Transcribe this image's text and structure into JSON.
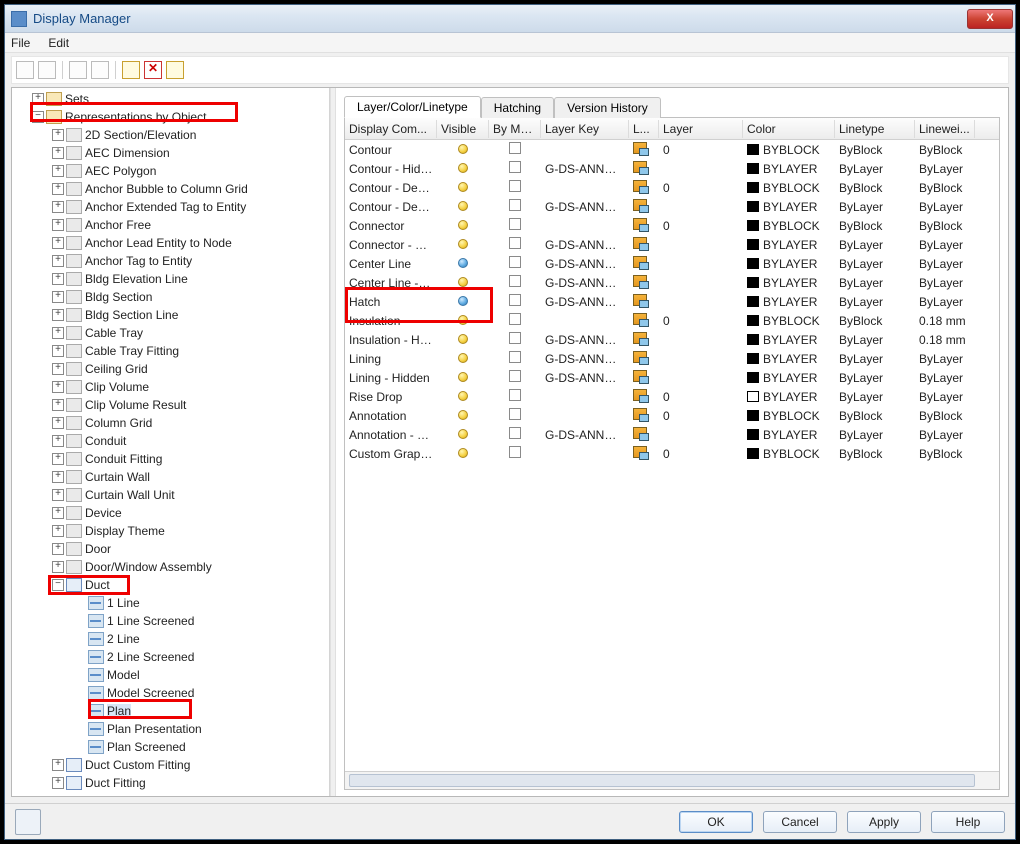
{
  "window": {
    "title": "Display Manager"
  },
  "menu": {
    "file": "File",
    "edit": "Edit"
  },
  "tree": {
    "sets": "Sets",
    "rep_by_obj": "Representations by Object",
    "items": [
      "2D Section/Elevation",
      "AEC Dimension",
      "AEC Polygon",
      "Anchor Bubble to Column Grid",
      "Anchor Extended Tag to Entity",
      "Anchor Free",
      "Anchor Lead Entity to Node",
      "Anchor Tag to Entity",
      "Bldg Elevation Line",
      "Bldg Section",
      "Bldg Section Line",
      "Cable Tray",
      "Cable Tray Fitting",
      "Ceiling Grid",
      "Clip Volume",
      "Clip Volume Result",
      "Column Grid",
      "Conduit",
      "Conduit Fitting",
      "Curtain Wall",
      "Curtain Wall Unit",
      "Device",
      "Display Theme",
      "Door",
      "Door/Window Assembly"
    ],
    "duct": "Duct",
    "duct_reps": [
      "1 Line",
      "1 Line Screened",
      "2 Line",
      "2 Line Screened",
      "Model",
      "Model Screened",
      "Plan",
      "Plan Presentation",
      "Plan Screened"
    ],
    "duct_custom": "Duct Custom Fitting",
    "duct_fitting": "Duct Fitting"
  },
  "tabs": {
    "lcl": "Layer/Color/Linetype",
    "hatch": "Hatching",
    "vh": "Version History"
  },
  "headers": [
    "Display Com...",
    "Visible",
    "By Mat...",
    "Layer Key",
    "L...",
    "Layer",
    "Color",
    "Linetype",
    "Linewei..."
  ],
  "rows": [
    {
      "name": "Contour",
      "bulb": "y",
      "key": "",
      "layer": "0",
      "color": "BYBLOCK",
      "lt": "ByBlock",
      "lw": "ByBlock",
      "sw": "b"
    },
    {
      "name": "Contour - Hidden",
      "bulb": "y",
      "key": "G-DS-ANNO-S...",
      "layer": "",
      "color": "BYLAYER",
      "lt": "ByLayer",
      "lw": "ByLayer",
      "sw": "b"
    },
    {
      "name": "Contour - Details",
      "bulb": "y",
      "key": "",
      "layer": "0",
      "color": "BYBLOCK",
      "lt": "ByBlock",
      "lw": "ByBlock",
      "sw": "b"
    },
    {
      "name": "Contour - Details -",
      "bulb": "y",
      "key": "G-DS-ANNO-S...",
      "layer": "",
      "color": "BYLAYER",
      "lt": "ByLayer",
      "lw": "ByLayer",
      "sw": "b"
    },
    {
      "name": "Connector",
      "bulb": "y",
      "key": "",
      "layer": "0",
      "color": "BYBLOCK",
      "lt": "ByBlock",
      "lw": "ByBlock",
      "sw": "b"
    },
    {
      "name": "Connector - Hidde",
      "bulb": "y",
      "key": "G-DS-ANNO-S...",
      "layer": "",
      "color": "BYLAYER",
      "lt": "ByLayer",
      "lw": "ByLayer",
      "sw": "b"
    },
    {
      "name": "Center Line",
      "bulb": "b",
      "key": "G-DS-ANNO-S...",
      "layer": "",
      "color": "BYLAYER",
      "lt": "ByLayer",
      "lw": "ByLayer",
      "sw": "b"
    },
    {
      "name": "Center Line - Hidd",
      "bulb": "y",
      "key": "G-DS-ANNO-S...",
      "layer": "",
      "color": "BYLAYER",
      "lt": "ByLayer",
      "lw": "ByLayer",
      "sw": "b"
    },
    {
      "name": "Hatch",
      "bulb": "b",
      "key": "G-DS-ANNO-S...",
      "layer": "",
      "color": "BYLAYER",
      "lt": "ByLayer",
      "lw": "ByLayer",
      "sw": "b"
    },
    {
      "name": "Insulation",
      "bulb": "y",
      "key": "",
      "layer": "0",
      "color": "BYBLOCK",
      "lt": "ByBlock",
      "lw": "0.18 mm",
      "sw": "b"
    },
    {
      "name": "Insulation - Hidden",
      "bulb": "y",
      "key": "G-DS-ANNO-S...",
      "layer": "",
      "color": "BYLAYER",
      "lt": "ByLayer",
      "lw": "0.18 mm",
      "sw": "b"
    },
    {
      "name": "Lining",
      "bulb": "y",
      "key": "G-DS-ANNO-S...",
      "layer": "",
      "color": "BYLAYER",
      "lt": "ByLayer",
      "lw": "ByLayer",
      "sw": "b"
    },
    {
      "name": "Lining - Hidden",
      "bulb": "y",
      "key": "G-DS-ANNO-S...",
      "layer": "",
      "color": "BYLAYER",
      "lt": "ByLayer",
      "lw": "ByLayer",
      "sw": "b"
    },
    {
      "name": "Rise Drop",
      "bulb": "y",
      "key": "",
      "layer": "0",
      "color": "BYLAYER",
      "lt": "ByLayer",
      "lw": "ByLayer",
      "sw": "o"
    },
    {
      "name": "Annotation",
      "bulb": "y",
      "key": "",
      "layer": "0",
      "color": "BYBLOCK",
      "lt": "ByBlock",
      "lw": "ByBlock",
      "sw": "b"
    },
    {
      "name": "Annotation - Hidde",
      "bulb": "y",
      "key": "G-DS-ANNO-S...",
      "layer": "",
      "color": "BYLAYER",
      "lt": "ByLayer",
      "lw": "ByLayer",
      "sw": "b"
    },
    {
      "name": "Custom Graphics",
      "bulb": "y",
      "key": "",
      "layer": "0",
      "color": "BYBLOCK",
      "lt": "ByBlock",
      "lw": "ByBlock",
      "sw": "b"
    }
  ],
  "footer": {
    "ok": "OK",
    "cancel": "Cancel",
    "apply": "Apply",
    "help": "Help"
  }
}
